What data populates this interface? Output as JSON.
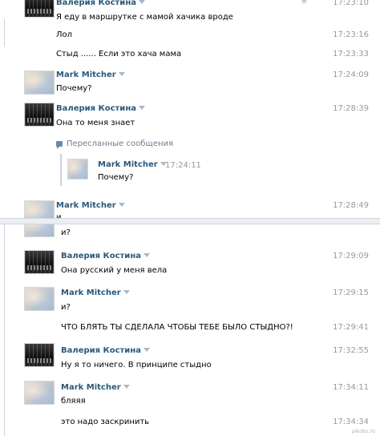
{
  "top_panel": {
    "messages": [
      {
        "sender": "Валерия Костина",
        "time": "17:23:10",
        "text": "Я еду в маршрутке с мамой хачика вроде",
        "star": "★"
      },
      {
        "text": "Лол",
        "time": "17:23:16"
      },
      {
        "text": "Стыд ...... Если это хача мама",
        "time": "17:23:33"
      },
      {
        "sender": "Mark Mitcher",
        "time": "17:24:09",
        "text": "Почему?"
      },
      {
        "sender": "Валерия Костина",
        "time": "17:28:39",
        "text": "Она то меня знает"
      },
      {
        "sender": "Mark Mitcher",
        "time": "17:28:49",
        "text": "и"
      }
    ],
    "forwarded": {
      "label": "Пересланные сообщения",
      "sender": "Mark Mitcher",
      "time": "17:24:11",
      "text": "Почему?"
    }
  },
  "bottom_panel": {
    "messages": [
      {
        "text": "и?"
      },
      {
        "sender": "Валерия Костина",
        "time": "17:29:09",
        "text": "Она русский у меня вела"
      },
      {
        "sender": "Mark Mitcher",
        "time": "17:29:15",
        "text": "и?"
      },
      {
        "text": "ЧТО БЛЯТЬ ТЫ СДЕЛАЛА ЧТОБЫ ТЕБЕ БЫЛО СТЫДНО?!",
        "time": "17:29:41"
      },
      {
        "sender": "Валерия Костина",
        "time": "17:32:55",
        "text": "Ну я то ничего. В принципе стыдно"
      },
      {
        "sender": "Mark Mitcher",
        "time": "17:34:11",
        "text": "бляяя"
      },
      {
        "text": "это надо заскринить",
        "time": "17:34:34"
      }
    ]
  },
  "watermark": "pikabu.ru",
  "colors": {
    "name": "#2b587a",
    "time": "#999999",
    "forwarded_label": "#6b7d90",
    "separator": "#eceef1"
  }
}
